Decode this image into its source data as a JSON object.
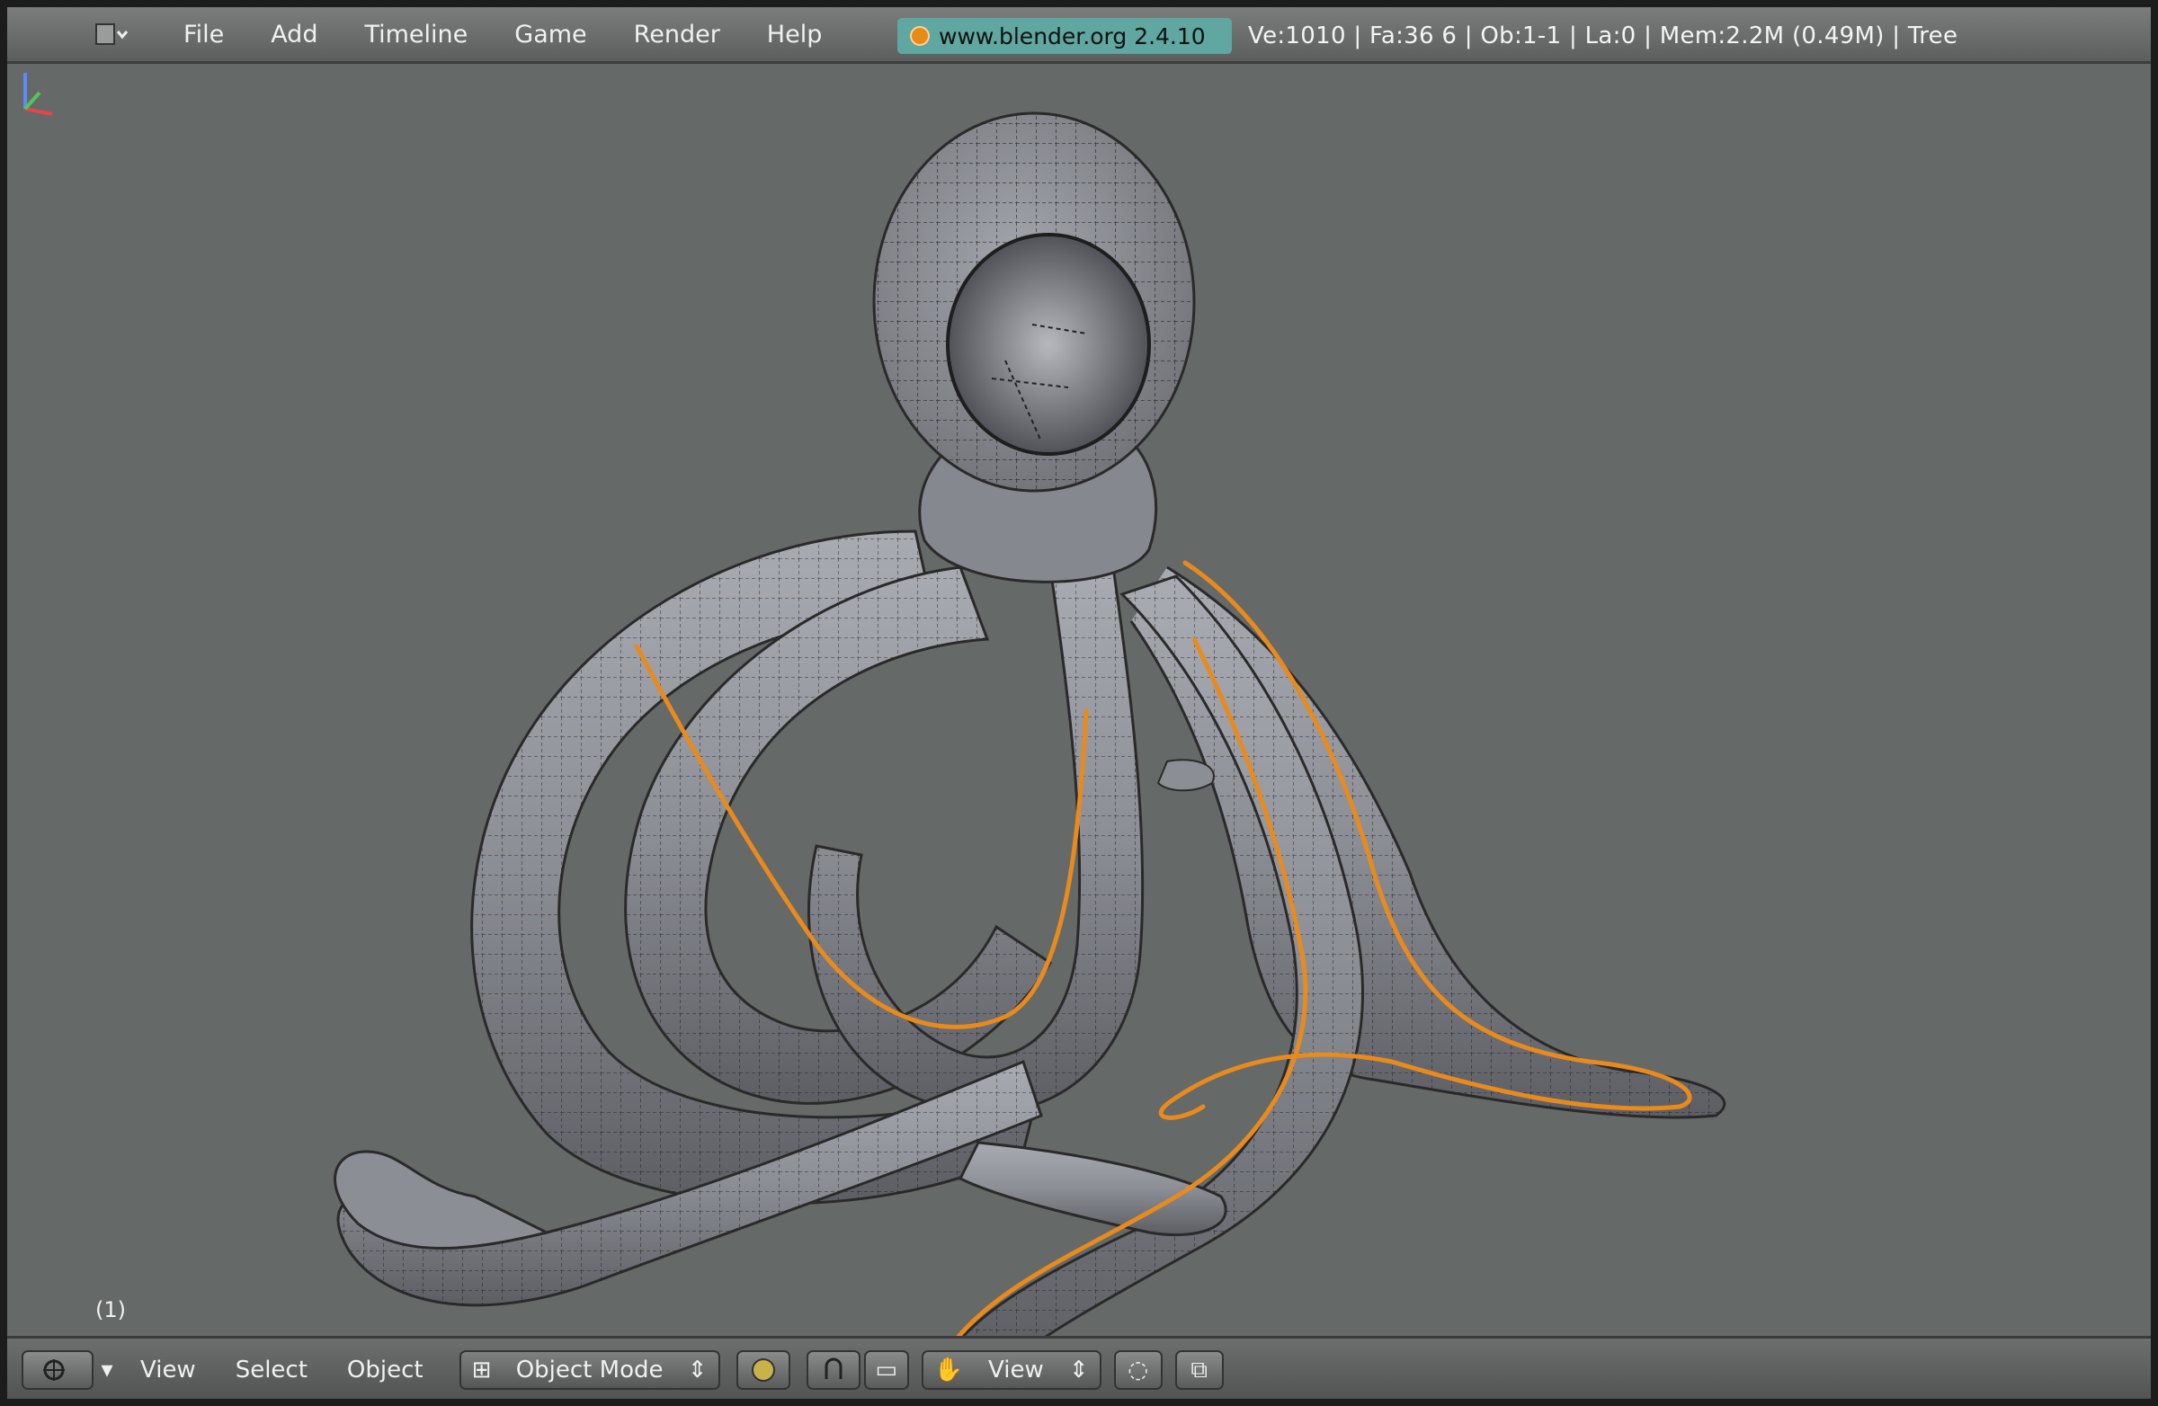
{
  "topbar": {
    "editor_type_icon": "info-icon",
    "menu": [
      "File",
      "Add",
      "Timeline",
      "Game",
      "Render",
      "Help"
    ],
    "scene_tab": "www.blender.org 2.4.10",
    "stats": "Ve:1010 | Fa:36 6 | Ob:1-1 | La:0  | Mem:2.2M (0.49M) | Tree"
  },
  "viewport": {
    "object_name": "(1)",
    "mesh_color": "#8e9096",
    "wire_color": "#111111",
    "curve_color": "#e88a1e",
    "background": "#656967"
  },
  "bottombar": {
    "editor_icon": "3d-view-icon",
    "menus": [
      "View",
      "Select",
      "Object"
    ],
    "mode_label": "Object Mode",
    "shading_icon": "shading-sphere-icon",
    "pivot_icon": "pivot-icon",
    "transform_label": "View",
    "layer_icon": "layers-icon",
    "snap_icon": "snap-icon"
  }
}
